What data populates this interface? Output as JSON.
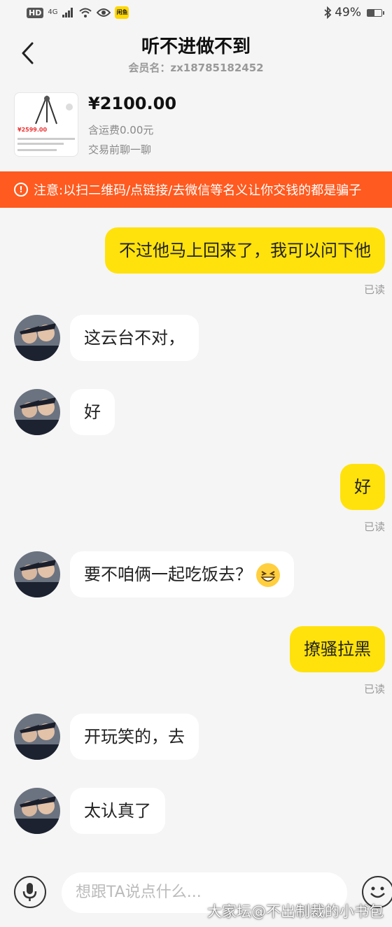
{
  "status_bar": {
    "hd": "HD",
    "network": "4G",
    "app_badge": "闲鱼",
    "battery": "49%",
    "battery_level": 0.49,
    "icons": [
      "signal-icon",
      "wifi-icon",
      "eye-icon",
      "bluetooth-icon",
      "battery-icon"
    ]
  },
  "header": {
    "title": "听不进做不到",
    "member_label": "会员名：zx18785182452"
  },
  "product": {
    "price": "¥2100.00",
    "shipping": "含运费0.00元",
    "pre_trade": "交易前聊一聊",
    "thumb_price": "¥2599.00"
  },
  "warning": {
    "text": "注意:以扫二维码/点链接/去微信等名义让你交钱的都是骗子"
  },
  "messages": [
    {
      "from": "me",
      "text": "不过他马上回来了，我可以问下他",
      "status": "已读"
    },
    {
      "from": "other",
      "text": "这云台不对，"
    },
    {
      "from": "other",
      "text": "好"
    },
    {
      "from": "me",
      "text": "好",
      "status": "已读"
    },
    {
      "from": "other",
      "text": "要不咱俩一起吃饭去？"
    },
    {
      "from": "me",
      "text": "撩骚拉黑",
      "status": "已读"
    },
    {
      "from": "other",
      "text": "开玩笑的，去"
    },
    {
      "from": "other",
      "text": "太认真了"
    }
  ],
  "input": {
    "placeholder": "想跟TA说点什么..."
  },
  "watermark": "大家坛@不出制裁的小书包",
  "colors": {
    "accent_yellow": "#ffe20c",
    "warning_orange": "#ff5a1f"
  }
}
